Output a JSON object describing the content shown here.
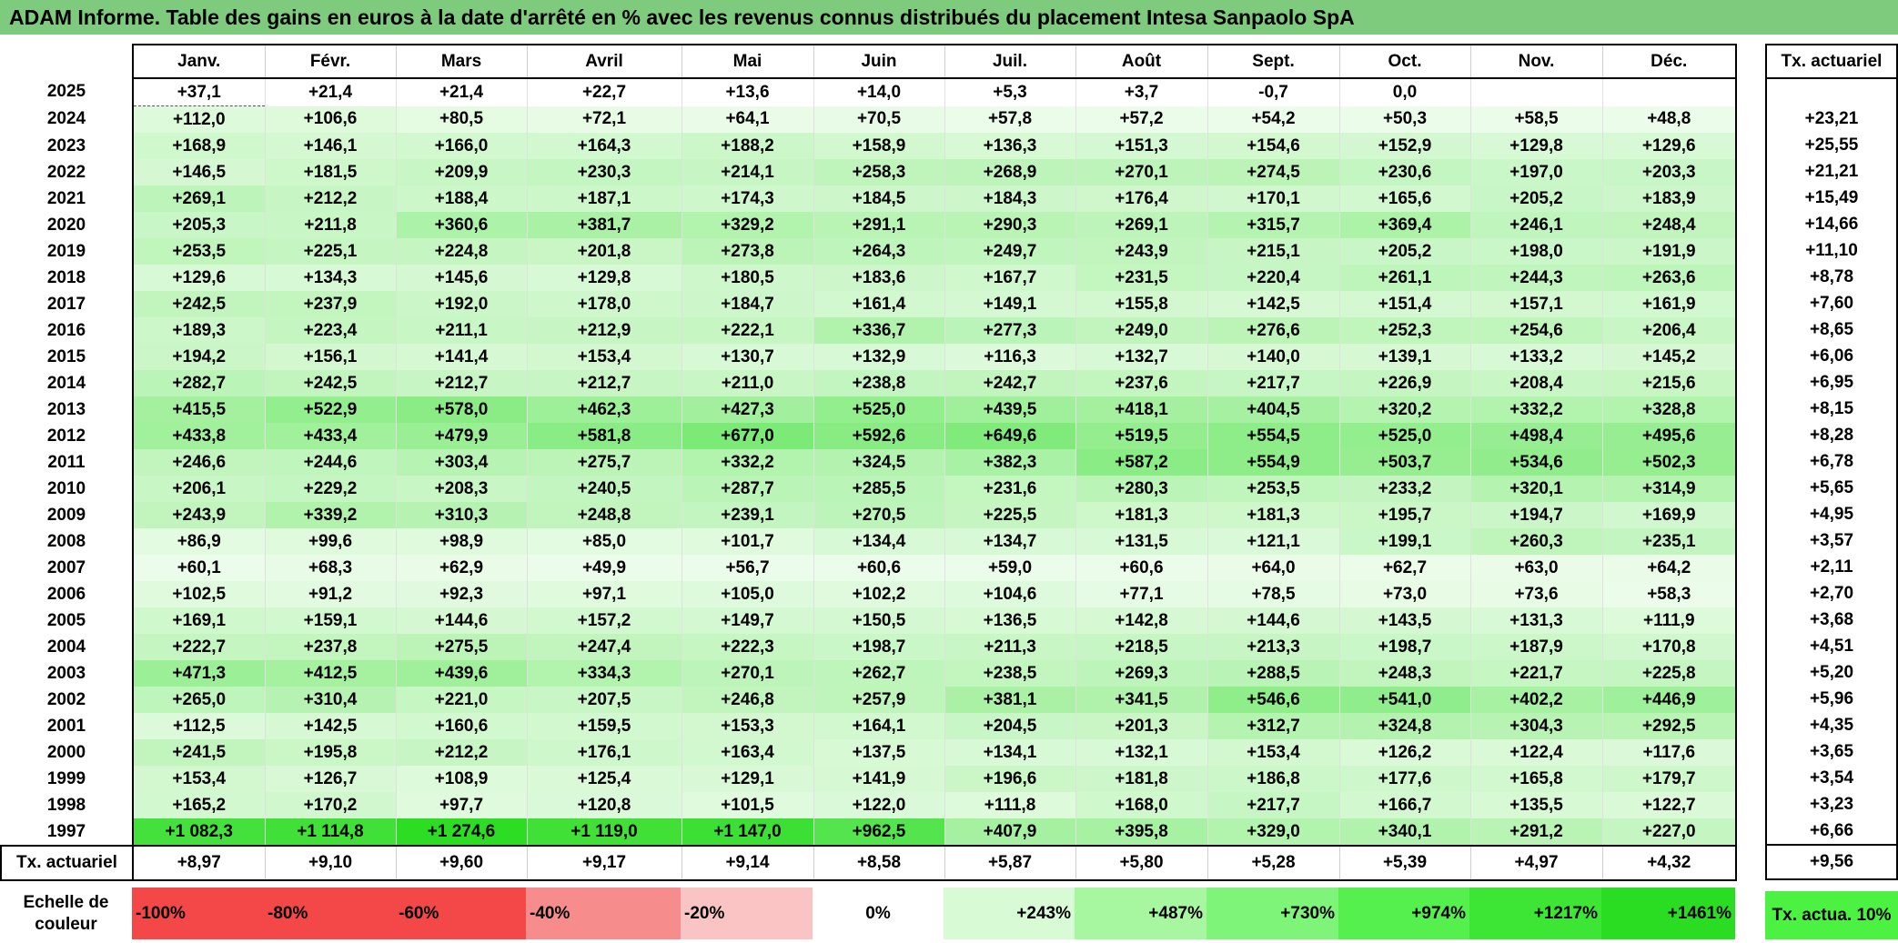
{
  "title": "ADAM Informe. Table des gains en euros à la date d'arrêté en % avec les revenus connus distribués du placement Intesa Sanpaolo SpA",
  "months": [
    "Janv.",
    "Févr.",
    "Mars",
    "Avril",
    "Mai",
    "Juin",
    "Juil.",
    "Août",
    "Sept.",
    "Oct.",
    "Nov.",
    "Déc."
  ],
  "actuarial_header": "Tx. actuariel",
  "rows": [
    {
      "year": "2025",
      "values": [
        "+37,1",
        "+21,4",
        "+21,4",
        "+22,7",
        "+13,6",
        "+14,0",
        "+5,3",
        "+3,7",
        "-0,7",
        "0,0",
        "",
        ""
      ],
      "rate": ""
    },
    {
      "year": "2024",
      "values": [
        "+112,0",
        "+106,6",
        "+80,5",
        "+72,1",
        "+64,1",
        "+70,5",
        "+57,8",
        "+57,2",
        "+54,2",
        "+50,3",
        "+58,5",
        "+48,8"
      ],
      "rate": "+23,21"
    },
    {
      "year": "2023",
      "values": [
        "+168,9",
        "+146,1",
        "+166,0",
        "+164,3",
        "+188,2",
        "+158,9",
        "+136,3",
        "+151,3",
        "+154,6",
        "+152,9",
        "+129,8",
        "+129,6"
      ],
      "rate": "+25,55"
    },
    {
      "year": "2022",
      "values": [
        "+146,5",
        "+181,5",
        "+209,9",
        "+230,3",
        "+214,1",
        "+258,3",
        "+268,9",
        "+270,1",
        "+274,5",
        "+230,6",
        "+197,0",
        "+203,3"
      ],
      "rate": "+21,21"
    },
    {
      "year": "2021",
      "values": [
        "+269,1",
        "+212,2",
        "+188,4",
        "+187,1",
        "+174,3",
        "+184,5",
        "+184,3",
        "+176,4",
        "+170,1",
        "+165,6",
        "+205,2",
        "+183,9"
      ],
      "rate": "+15,49"
    },
    {
      "year": "2020",
      "values": [
        "+205,3",
        "+211,8",
        "+360,6",
        "+381,7",
        "+329,2",
        "+291,1",
        "+290,3",
        "+269,1",
        "+315,7",
        "+369,4",
        "+246,1",
        "+248,4"
      ],
      "rate": "+14,66"
    },
    {
      "year": "2019",
      "values": [
        "+253,5",
        "+225,1",
        "+224,8",
        "+201,8",
        "+273,8",
        "+264,3",
        "+249,7",
        "+243,9",
        "+215,1",
        "+205,2",
        "+198,0",
        "+191,9"
      ],
      "rate": "+11,10"
    },
    {
      "year": "2018",
      "values": [
        "+129,6",
        "+134,3",
        "+145,6",
        "+129,8",
        "+180,5",
        "+183,6",
        "+167,7",
        "+231,5",
        "+220,4",
        "+261,1",
        "+244,3",
        "+263,6"
      ],
      "rate": "+8,78"
    },
    {
      "year": "2017",
      "values": [
        "+242,5",
        "+237,9",
        "+192,0",
        "+178,0",
        "+184,7",
        "+161,4",
        "+149,1",
        "+155,8",
        "+142,5",
        "+151,4",
        "+157,1",
        "+161,9"
      ],
      "rate": "+7,60"
    },
    {
      "year": "2016",
      "values": [
        "+189,3",
        "+223,4",
        "+211,1",
        "+212,9",
        "+222,1",
        "+336,7",
        "+277,3",
        "+249,0",
        "+276,6",
        "+252,3",
        "+254,6",
        "+206,4"
      ],
      "rate": "+8,65"
    },
    {
      "year": "2015",
      "values": [
        "+194,2",
        "+156,1",
        "+141,4",
        "+153,4",
        "+130,7",
        "+132,9",
        "+116,3",
        "+132,7",
        "+140,0",
        "+139,1",
        "+133,2",
        "+145,2"
      ],
      "rate": "+6,06"
    },
    {
      "year": "2014",
      "values": [
        "+282,7",
        "+242,5",
        "+212,7",
        "+212,7",
        "+211,0",
        "+238,8",
        "+242,7",
        "+237,6",
        "+217,7",
        "+226,9",
        "+208,4",
        "+215,6"
      ],
      "rate": "+6,95"
    },
    {
      "year": "2013",
      "values": [
        "+415,5",
        "+522,9",
        "+578,0",
        "+462,3",
        "+427,3",
        "+525,0",
        "+439,5",
        "+418,1",
        "+404,5",
        "+320,2",
        "+332,2",
        "+328,8"
      ],
      "rate": "+8,15"
    },
    {
      "year": "2012",
      "values": [
        "+433,8",
        "+433,4",
        "+479,9",
        "+581,8",
        "+677,0",
        "+592,6",
        "+649,6",
        "+519,5",
        "+554,5",
        "+525,0",
        "+498,4",
        "+495,6"
      ],
      "rate": "+8,28"
    },
    {
      "year": "2011",
      "values": [
        "+246,6",
        "+244,6",
        "+303,4",
        "+275,7",
        "+332,2",
        "+324,5",
        "+382,3",
        "+587,2",
        "+554,9",
        "+503,7",
        "+534,6",
        "+502,3"
      ],
      "rate": "+6,78"
    },
    {
      "year": "2010",
      "values": [
        "+206,1",
        "+229,2",
        "+208,3",
        "+240,5",
        "+287,7",
        "+285,5",
        "+231,6",
        "+280,3",
        "+253,5",
        "+233,2",
        "+320,1",
        "+314,9"
      ],
      "rate": "+5,65"
    },
    {
      "year": "2009",
      "values": [
        "+243,9",
        "+339,2",
        "+310,3",
        "+248,8",
        "+239,1",
        "+270,5",
        "+225,5",
        "+181,3",
        "+181,3",
        "+195,7",
        "+194,7",
        "+169,9"
      ],
      "rate": "+4,95"
    },
    {
      "year": "2008",
      "values": [
        "+86,9",
        "+99,6",
        "+98,9",
        "+85,0",
        "+101,7",
        "+134,4",
        "+134,7",
        "+131,5",
        "+121,1",
        "+199,1",
        "+260,3",
        "+235,1"
      ],
      "rate": "+3,57"
    },
    {
      "year": "2007",
      "values": [
        "+60,1",
        "+68,3",
        "+62,9",
        "+49,9",
        "+56,7",
        "+60,6",
        "+59,0",
        "+60,6",
        "+64,0",
        "+62,7",
        "+63,0",
        "+64,2"
      ],
      "rate": "+2,11"
    },
    {
      "year": "2006",
      "values": [
        "+102,5",
        "+91,2",
        "+92,3",
        "+97,1",
        "+105,0",
        "+102,2",
        "+104,6",
        "+77,1",
        "+78,5",
        "+73,0",
        "+73,6",
        "+58,3"
      ],
      "rate": "+2,70"
    },
    {
      "year": "2005",
      "values": [
        "+169,1",
        "+159,1",
        "+144,6",
        "+157,2",
        "+149,7",
        "+150,5",
        "+136,5",
        "+142,8",
        "+144,6",
        "+143,5",
        "+131,3",
        "+111,9"
      ],
      "rate": "+3,68"
    },
    {
      "year": "2004",
      "values": [
        "+222,7",
        "+237,8",
        "+275,5",
        "+247,4",
        "+222,3",
        "+198,7",
        "+211,3",
        "+218,5",
        "+213,3",
        "+198,7",
        "+187,9",
        "+170,8"
      ],
      "rate": "+4,51"
    },
    {
      "year": "2003",
      "values": [
        "+471,3",
        "+412,5",
        "+439,6",
        "+334,3",
        "+270,1",
        "+262,7",
        "+238,5",
        "+269,3",
        "+288,5",
        "+248,3",
        "+221,7",
        "+225,8"
      ],
      "rate": "+5,20"
    },
    {
      "year": "2002",
      "values": [
        "+265,0",
        "+310,4",
        "+221,0",
        "+207,5",
        "+246,8",
        "+257,9",
        "+381,1",
        "+341,5",
        "+546,6",
        "+541,0",
        "+402,2",
        "+446,9"
      ],
      "rate": "+5,96"
    },
    {
      "year": "2001",
      "values": [
        "+112,5",
        "+142,5",
        "+160,6",
        "+159,5",
        "+153,3",
        "+164,1",
        "+204,5",
        "+201,3",
        "+312,7",
        "+324,8",
        "+304,3",
        "+292,5"
      ],
      "rate": "+4,35"
    },
    {
      "year": "2000",
      "values": [
        "+241,5",
        "+195,8",
        "+212,2",
        "+176,1",
        "+163,4",
        "+137,5",
        "+134,1",
        "+132,1",
        "+153,4",
        "+126,2",
        "+122,4",
        "+117,6"
      ],
      "rate": "+3,65"
    },
    {
      "year": "1999",
      "values": [
        "+153,4",
        "+126,7",
        "+108,9",
        "+125,4",
        "+129,1",
        "+141,9",
        "+196,6",
        "+181,8",
        "+186,8",
        "+177,6",
        "+165,8",
        "+179,7"
      ],
      "rate": "+3,54"
    },
    {
      "year": "1998",
      "values": [
        "+165,2",
        "+170,2",
        "+97,7",
        "+120,8",
        "+101,5",
        "+122,0",
        "+111,8",
        "+168,0",
        "+217,7",
        "+166,7",
        "+135,5",
        "+122,7"
      ],
      "rate": "+3,23"
    },
    {
      "year": "1997",
      "values": [
        "+1 082,3",
        "+1 114,8",
        "+1 274,6",
        "+1 119,0",
        "+1 147,0",
        "+962,5",
        "+407,9",
        "+395,8",
        "+329,0",
        "+340,1",
        "+291,2",
        "+227,0"
      ],
      "rate": "+6,66"
    }
  ],
  "total_row": {
    "label": "Tx. actuariel",
    "values": [
      "+8,97",
      "+9,10",
      "+9,60",
      "+9,17",
      "+9,14",
      "+8,58",
      "+5,87",
      "+5,80",
      "+5,28",
      "+5,39",
      "+4,97",
      "+4,32"
    ],
    "rate": "+9,56"
  },
  "legend": {
    "label": "Echelle de couleur",
    "steps": [
      {
        "text": "-100%",
        "color": "#f44848",
        "kind": "neg"
      },
      {
        "text": "-80%",
        "color": "#f44848",
        "kind": "neg"
      },
      {
        "text": "-60%",
        "color": "#f44848",
        "kind": "neg"
      },
      {
        "text": "-40%",
        "color": "#f68c8c",
        "kind": "neg"
      },
      {
        "text": "-20%",
        "color": "#fbc4c4",
        "kind": "neg"
      },
      {
        "text": "0%",
        "color": "#ffffff",
        "kind": "zero"
      },
      {
        "text": "+243%",
        "color": "#d8fad5",
        "kind": "pos"
      },
      {
        "text": "+487%",
        "color": "#a7f7a1",
        "kind": "pos"
      },
      {
        "text": "+730%",
        "color": "#7ef478",
        "kind": "pos"
      },
      {
        "text": "+974%",
        "color": "#55f04d",
        "kind": "pos"
      },
      {
        "text": "+1217%",
        "color": "#3de534",
        "kind": "pos"
      },
      {
        "text": "+1461%",
        "color": "#2bdd22",
        "kind": "pos"
      }
    ],
    "target_label": "Tx. actua. 10%",
    "target_color": "#4cf241"
  },
  "colors": {
    "title_bg": "#7fcb7d",
    "scale_min_green": "#ecfcea",
    "scale_max_green": "#2bdd22"
  }
}
